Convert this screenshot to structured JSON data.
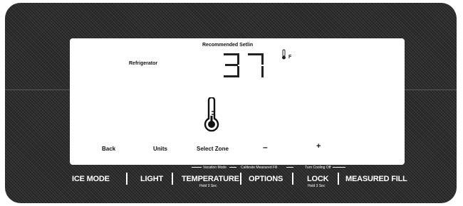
{
  "display": {
    "header": "Recommended Setlin",
    "zone_name": "Refrigerator",
    "temperature": "37",
    "unit": "F",
    "icons": {
      "degree": "thermometer-small-icon",
      "main": "thermometer-icon"
    }
  },
  "softkeys": {
    "back": "Back",
    "units": "Units",
    "select_zone": "Select Zone",
    "minus": "–",
    "plus": "+"
  },
  "hints": {
    "vacation": "Vacation Mode",
    "calibrate": "Calibrate Measured Fill",
    "cooling_off": "Turn Cooling Off"
  },
  "buttons": {
    "ice_mode": "ICE MODE",
    "light": "LIGHT",
    "temperature": "TEMPERATURE",
    "temperature_hold": "Hold 3 Sec",
    "options": "OPTIONS",
    "lock": "LOCK",
    "lock_hold": "Hold 3 Sec",
    "measured_fill": "MEASURED FILL"
  }
}
